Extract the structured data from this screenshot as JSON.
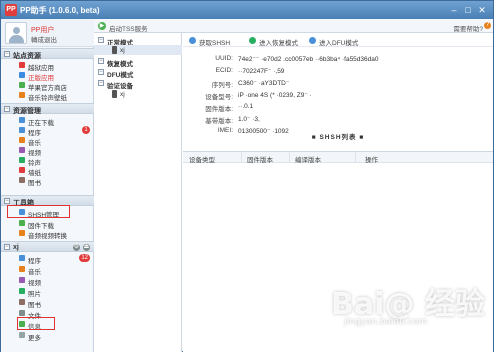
{
  "app": {
    "title": "PP助手 (1.0.6.0, beta)",
    "logo": "PP",
    "window_buttons": [
      "–",
      "□",
      "✕"
    ]
  },
  "user": {
    "name": "PP用户",
    "logout": "轉成退出"
  },
  "sidebar": {
    "sections": [
      {
        "label": "站点资源",
        "items": [
          {
            "label": "越狱应用",
            "color": "#e23b3b"
          },
          {
            "label": "正版应用",
            "color": "#3b8be2",
            "active": true
          },
          {
            "label": "苹果官方商店",
            "color": "#4caf50"
          },
          {
            "label": "音乐铃声壁纸",
            "color": "#e8821f"
          }
        ]
      },
      {
        "label": "资源管理",
        "items": [
          {
            "label": "正在下载",
            "color": "#4a90d9"
          },
          {
            "label": "程序",
            "color": "#4a90d9",
            "badge": "1"
          },
          {
            "label": "音乐",
            "color": "#e8821f"
          },
          {
            "label": "视频",
            "color": "#9b59b6"
          },
          {
            "label": "铃声",
            "color": "#27ae60"
          },
          {
            "label": "墙纸",
            "color": "#e23b3b"
          },
          {
            "label": "图书",
            "color": "#8d6e63"
          }
        ]
      },
      {
        "label": "工具箱",
        "items": [
          {
            "label": "SHSH管理",
            "color": "#4a90d9",
            "highlight": true
          },
          {
            "label": "固件下载",
            "color": "#4caf50"
          },
          {
            "label": "音频视频转换",
            "color": "#e8821f"
          }
        ]
      },
      {
        "label": "xj",
        "items": [
          {
            "label": "程序",
            "color": "#4a90d9",
            "badge": "12"
          },
          {
            "label": "音乐",
            "color": "#e8821f"
          },
          {
            "label": "视频",
            "color": "#9b59b6"
          },
          {
            "label": "照片",
            "color": "#27ae60"
          },
          {
            "label": "图书",
            "color": "#8d6e63"
          },
          {
            "label": "文件",
            "color": "#7f8c8d"
          },
          {
            "label": "信息",
            "color": "#4caf50",
            "highlight": true
          },
          {
            "label": "更多",
            "color": "#95a5a6"
          }
        ]
      }
    ]
  },
  "toolbar": {
    "tss_button": "启动TSS服务",
    "help": "需要帮助?"
  },
  "tree": {
    "groups": [
      {
        "label": "正常模式",
        "devices": [
          "xj"
        ]
      },
      {
        "label": "恢复模式",
        "devices": []
      },
      {
        "label": "DFU模式",
        "devices": []
      },
      {
        "label": "验证设备",
        "devices": [
          "xj"
        ]
      }
    ]
  },
  "actions": {
    "get_shsh": "获取SHSH",
    "enter_recovery": "进入恢复模式",
    "enter_dfu": "进入DFU模式"
  },
  "device_info": [
    {
      "key": "UUID:",
      "value": "74e2⁻⁻ ·e70d2 .cc0057eb ··6b3ba⁴ ·fa55d36da0"
    },
    {
      "key": "ECID:",
      "value": "··702247F⁻ ·,59"
    },
    {
      "key": "序列号:",
      "value": "C360⁻ ·aY3DTD⁻"
    },
    {
      "key": "设备型号:",
      "value": "iP ·one 4S (* ·0239, Z9⁻ ·"
    },
    {
      "key": "固件版本:",
      "value": "··.0.1"
    },
    {
      "key": "基带版本:",
      "value": "1.0⁻ ·3,"
    },
    {
      "key": "IMEI:",
      "value": "01300500⁻ ·1092"
    }
  ],
  "shsh": {
    "title": "SHSH列表",
    "columns": [
      "设备类型",
      "固件版本",
      "编译版本",
      "操作"
    ]
  },
  "watermark": {
    "big": "Bai@ 经验",
    "small": "jingyan.baidu.com"
  }
}
